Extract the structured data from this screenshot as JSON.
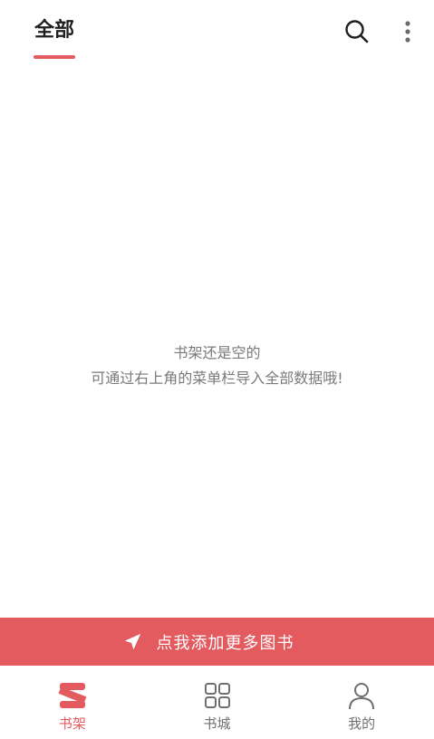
{
  "header": {
    "tab_label": "全部"
  },
  "empty_state": {
    "line1": "书架还是空的",
    "line2": "可通过右上角的菜单栏导入全部数据哦!"
  },
  "add_bar": {
    "label": "点我添加更多图书"
  },
  "bottom_nav": {
    "items": [
      {
        "label": "书架",
        "icon": "bookshelf-icon",
        "active": true
      },
      {
        "label": "书城",
        "icon": "grid-icon",
        "active": false
      },
      {
        "label": "我的",
        "icon": "user-icon",
        "active": false
      }
    ]
  },
  "colors": {
    "accent": "#e35a5f",
    "text_dark": "#1f1f1f",
    "text_muted": "#7a7a7a",
    "background": "#ffffff"
  }
}
